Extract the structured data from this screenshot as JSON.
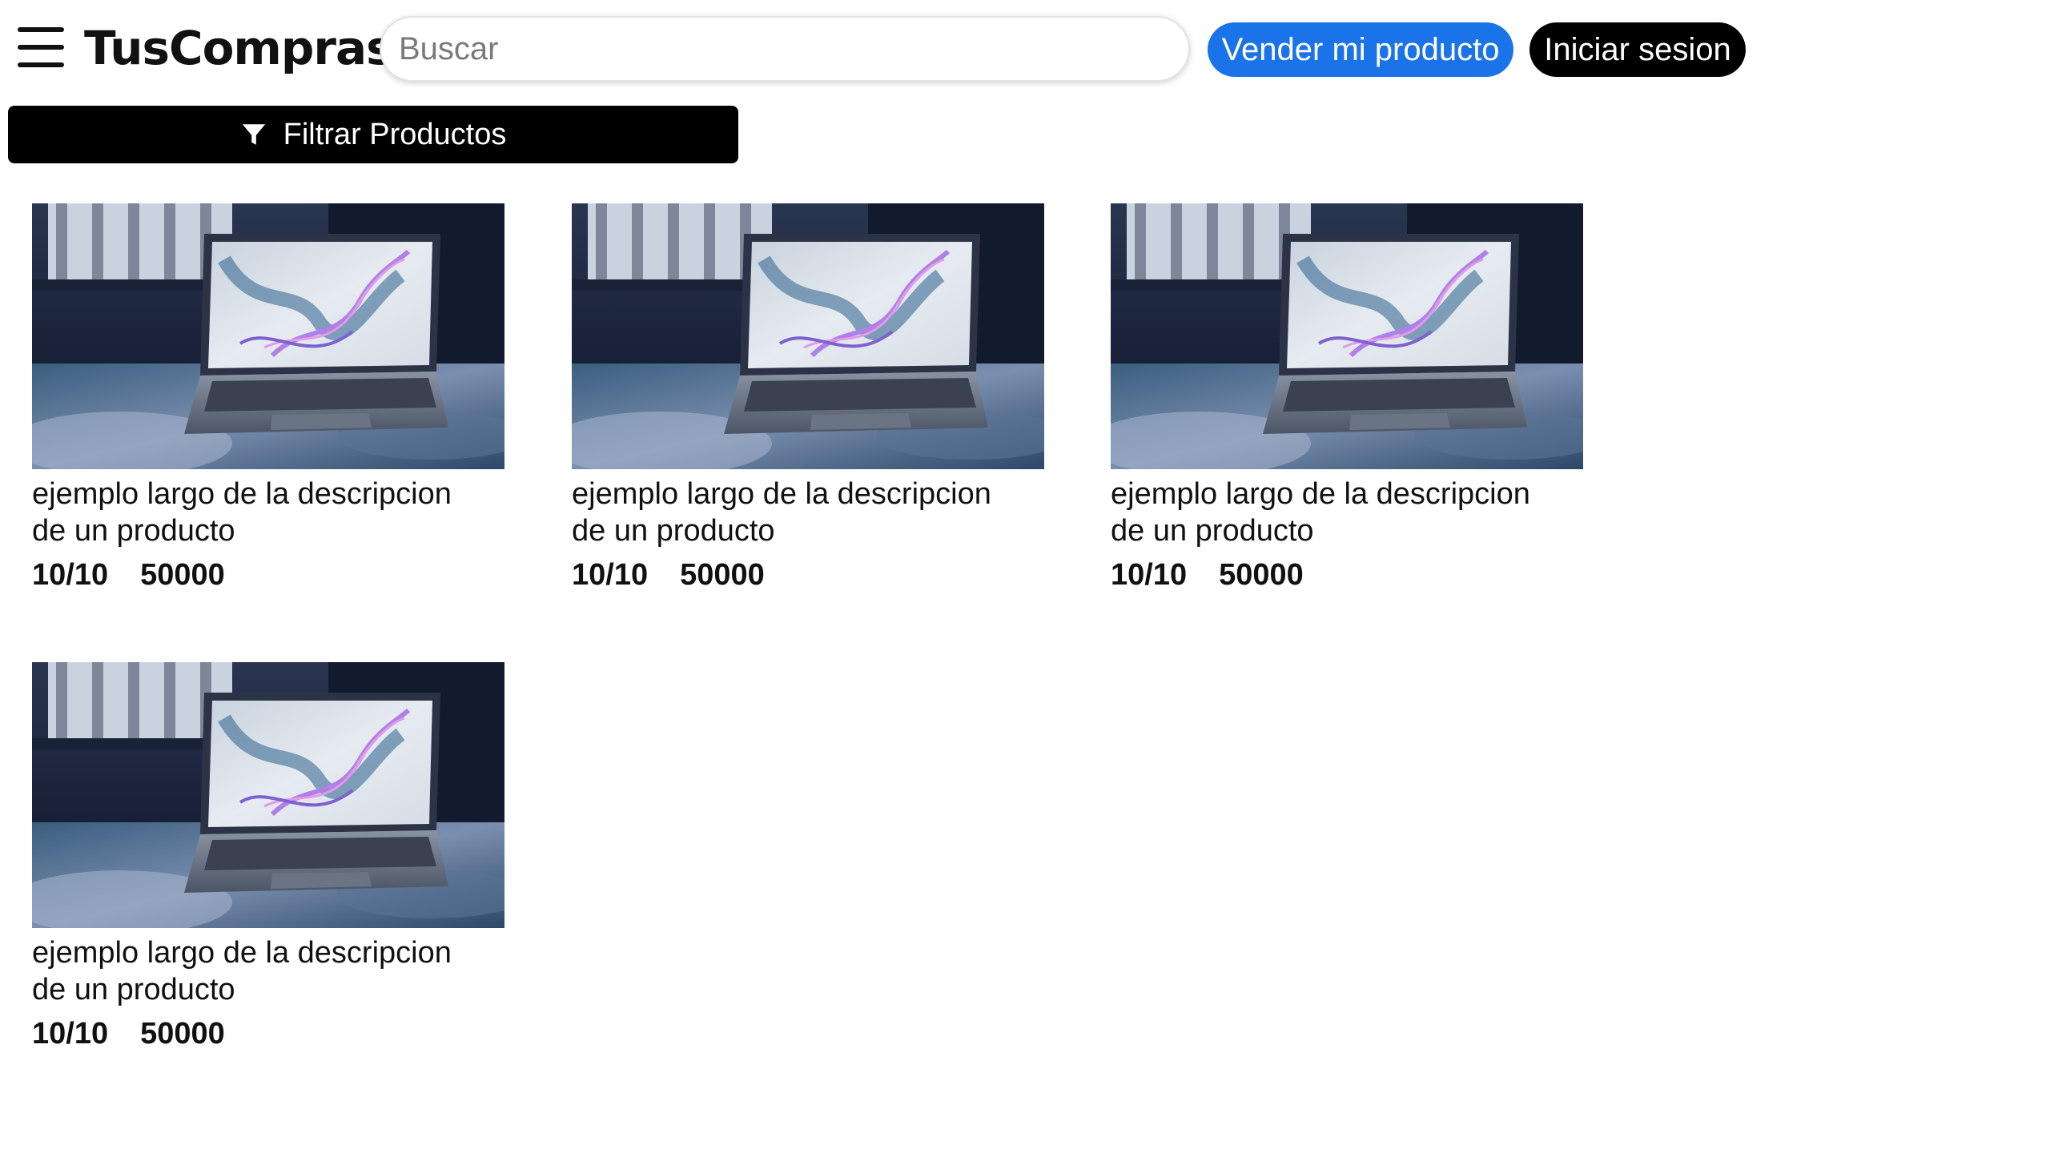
{
  "header": {
    "logo": "TusCompras",
    "search_placeholder": "Buscar",
    "sell_button": "Vender mi producto",
    "login_button": "Iniciar sesion"
  },
  "filter": {
    "label": "Filtrar Productos"
  },
  "products": [
    {
      "description": "ejemplo largo de la descripcion de un producto",
      "rating": "10/10",
      "price": "50000"
    },
    {
      "description": "ejemplo largo de la descripcion de un producto",
      "rating": "10/10",
      "price": "50000"
    },
    {
      "description": "ejemplo largo de la descripcion de un producto",
      "rating": "10/10",
      "price": "50000"
    },
    {
      "description": "ejemplo largo de la descripcion de un producto",
      "rating": "10/10",
      "price": "50000"
    }
  ],
  "colors": {
    "accent": "#1a73e8",
    "dark": "#000000"
  }
}
